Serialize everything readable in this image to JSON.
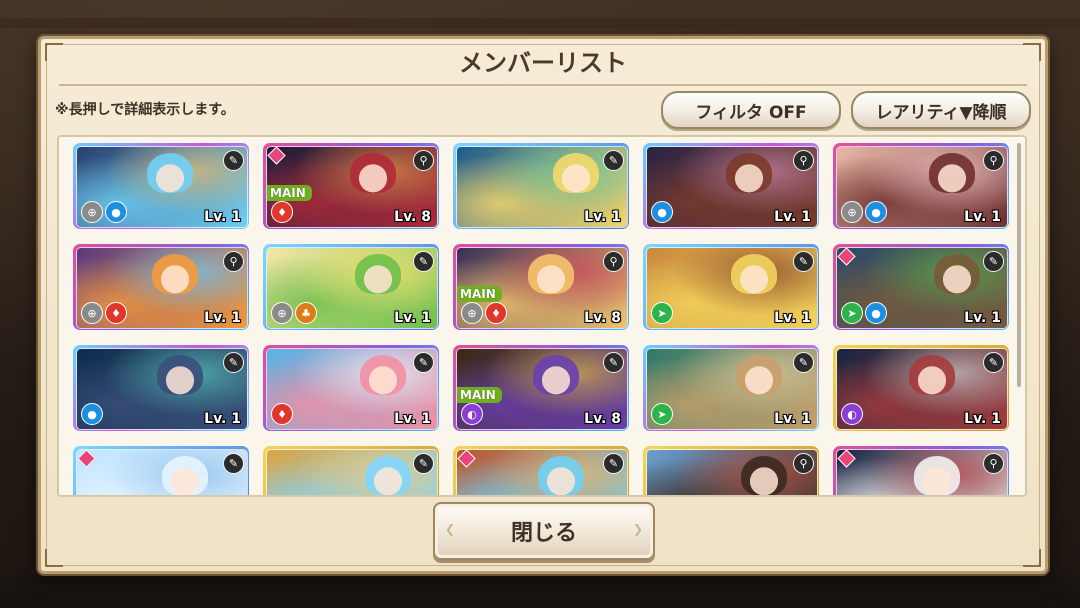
{
  "dialog": {
    "title": "メンバーリスト",
    "hint": "※長押しで詳細表示します。",
    "filter_label": "フィルタ OFF",
    "sort_label": "レアリティ▼降順",
    "close_label": "閉じる"
  },
  "colors": {
    "frame_ur": "#c74fd6",
    "frame_sr": "#4b7ad9",
    "frame_gold": "#e4c13b",
    "main_badge": "#6fae1e"
  },
  "cards": [
    {
      "level": "Lv. 1",
      "main": false,
      "diamond": false,
      "tool": "wrench-icon",
      "icons": [
        "position",
        "water"
      ]
    },
    {
      "level": "Lv. 8",
      "main": true,
      "main_label": "MAIN",
      "diamond": true,
      "tool": "search-icon",
      "icons": [
        "fire"
      ]
    },
    {
      "level": "Lv. 1",
      "main": false,
      "diamond": false,
      "tool": "wrench-icon",
      "icons": []
    },
    {
      "level": "Lv. 1",
      "main": false,
      "diamond": false,
      "tool": "search-icon",
      "icons": [
        "water"
      ]
    },
    {
      "level": "Lv. 1",
      "main": false,
      "diamond": false,
      "tool": "search-icon",
      "icons": [
        "position",
        "water"
      ]
    },
    {
      "level": "Lv. 1",
      "main": false,
      "diamond": false,
      "tool": "search-icon",
      "icons": [
        "position",
        "fire"
      ]
    },
    {
      "level": "Lv. 1",
      "main": false,
      "diamond": false,
      "tool": "wrench-icon",
      "icons": [
        "position",
        "earth"
      ]
    },
    {
      "level": "Lv. 8",
      "main": true,
      "main_label": "MAIN",
      "diamond": false,
      "tool": "search-icon",
      "icons": [
        "position",
        "fire"
      ]
    },
    {
      "level": "Lv. 1",
      "main": false,
      "diamond": false,
      "tool": "wrench-icon",
      "icons": [
        "wind"
      ]
    },
    {
      "level": "Lv. 1",
      "main": false,
      "diamond": true,
      "tool": "wrench-icon",
      "icons": [
        "wind",
        "water"
      ]
    },
    {
      "level": "Lv. 1",
      "main": false,
      "diamond": false,
      "tool": "wrench-icon",
      "icons": [
        "water"
      ]
    },
    {
      "level": "Lv. 1",
      "main": false,
      "diamond": false,
      "tool": "wrench-icon",
      "icons": [
        "fire"
      ]
    },
    {
      "level": "Lv. 8",
      "main": true,
      "main_label": "MAIN",
      "diamond": false,
      "tool": "wrench-icon",
      "icons": [
        "dark"
      ]
    },
    {
      "level": "Lv. 1",
      "main": false,
      "diamond": false,
      "tool": "wrench-icon",
      "icons": [
        "wind"
      ]
    },
    {
      "level": "Lv. 1",
      "main": false,
      "diamond": false,
      "tool": "wrench-icon",
      "icons": [
        "dark"
      ]
    },
    {
      "level": "",
      "main": false,
      "diamond": true,
      "tool": "wrench-icon",
      "icons": []
    },
    {
      "level": "",
      "main": false,
      "diamond": false,
      "tool": "wrench-icon",
      "icons": []
    },
    {
      "level": "",
      "main": false,
      "diamond": true,
      "tool": "wrench-icon",
      "icons": []
    },
    {
      "level": "",
      "main": false,
      "diamond": false,
      "tool": "search-icon",
      "icons": []
    },
    {
      "level": "",
      "main": false,
      "diamond": true,
      "tool": "search-icon",
      "icons": []
    }
  ]
}
